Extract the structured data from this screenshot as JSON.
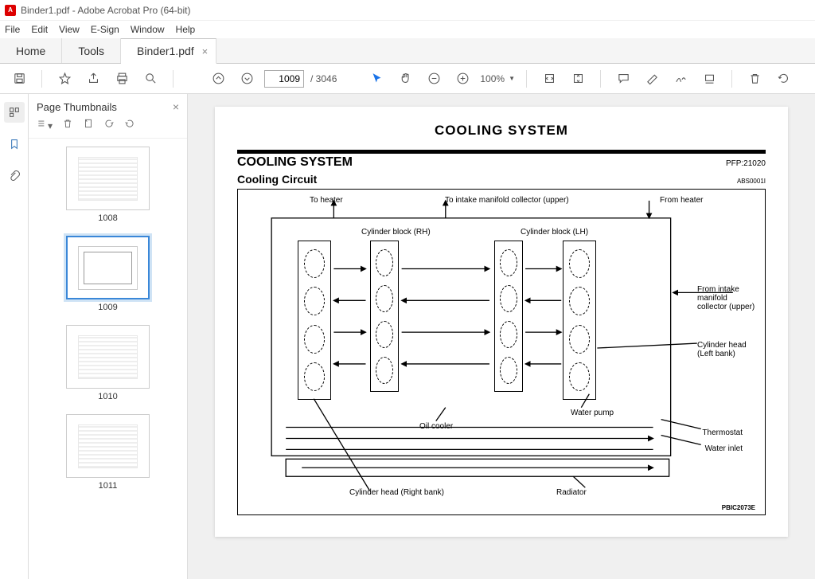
{
  "app": {
    "title": "Binder1.pdf - Adobe Acrobat Pro (64-bit)"
  },
  "menu": {
    "file": "File",
    "edit": "Edit",
    "view": "View",
    "esign": "E-Sign",
    "window": "Window",
    "help": "Help"
  },
  "tabs": {
    "home": "Home",
    "tools": "Tools",
    "doc": "Binder1.pdf"
  },
  "toolbar": {
    "page": "1009",
    "pagecount": "/ 3046",
    "zoom": "100%"
  },
  "thumbs": {
    "title": "Page Thumbnails",
    "items": [
      {
        "label": "1008"
      },
      {
        "label": "1009"
      },
      {
        "label": "1010"
      },
      {
        "label": "1011"
      }
    ]
  },
  "doc": {
    "title": "COOLING SYSTEM",
    "section": "COOLING SYSTEM",
    "ref": "PFP:21020",
    "subsection": "Cooling Circuit",
    "ref2": "ABS0001I",
    "labels": {
      "to_heater": "To heater",
      "to_intake": "To intake manifold collector (upper)",
      "from_heater": "From heater",
      "from_intake": "From intake manifold collector (upper)",
      "cyl_block_rh": "Cylinder block (RH)",
      "cyl_block_lh": "Cylinder block (LH)",
      "cyl_head_lb": "Cylinder head (Left bank)",
      "oil_cooler": "Oil cooler",
      "water_pump": "Water pump",
      "thermostat": "Thermostat",
      "water_inlet": "Water inlet",
      "radiator": "Radiator",
      "cyl_head_rb": "Cylinder head (Right bank)",
      "code": "PBIC2073E"
    }
  }
}
